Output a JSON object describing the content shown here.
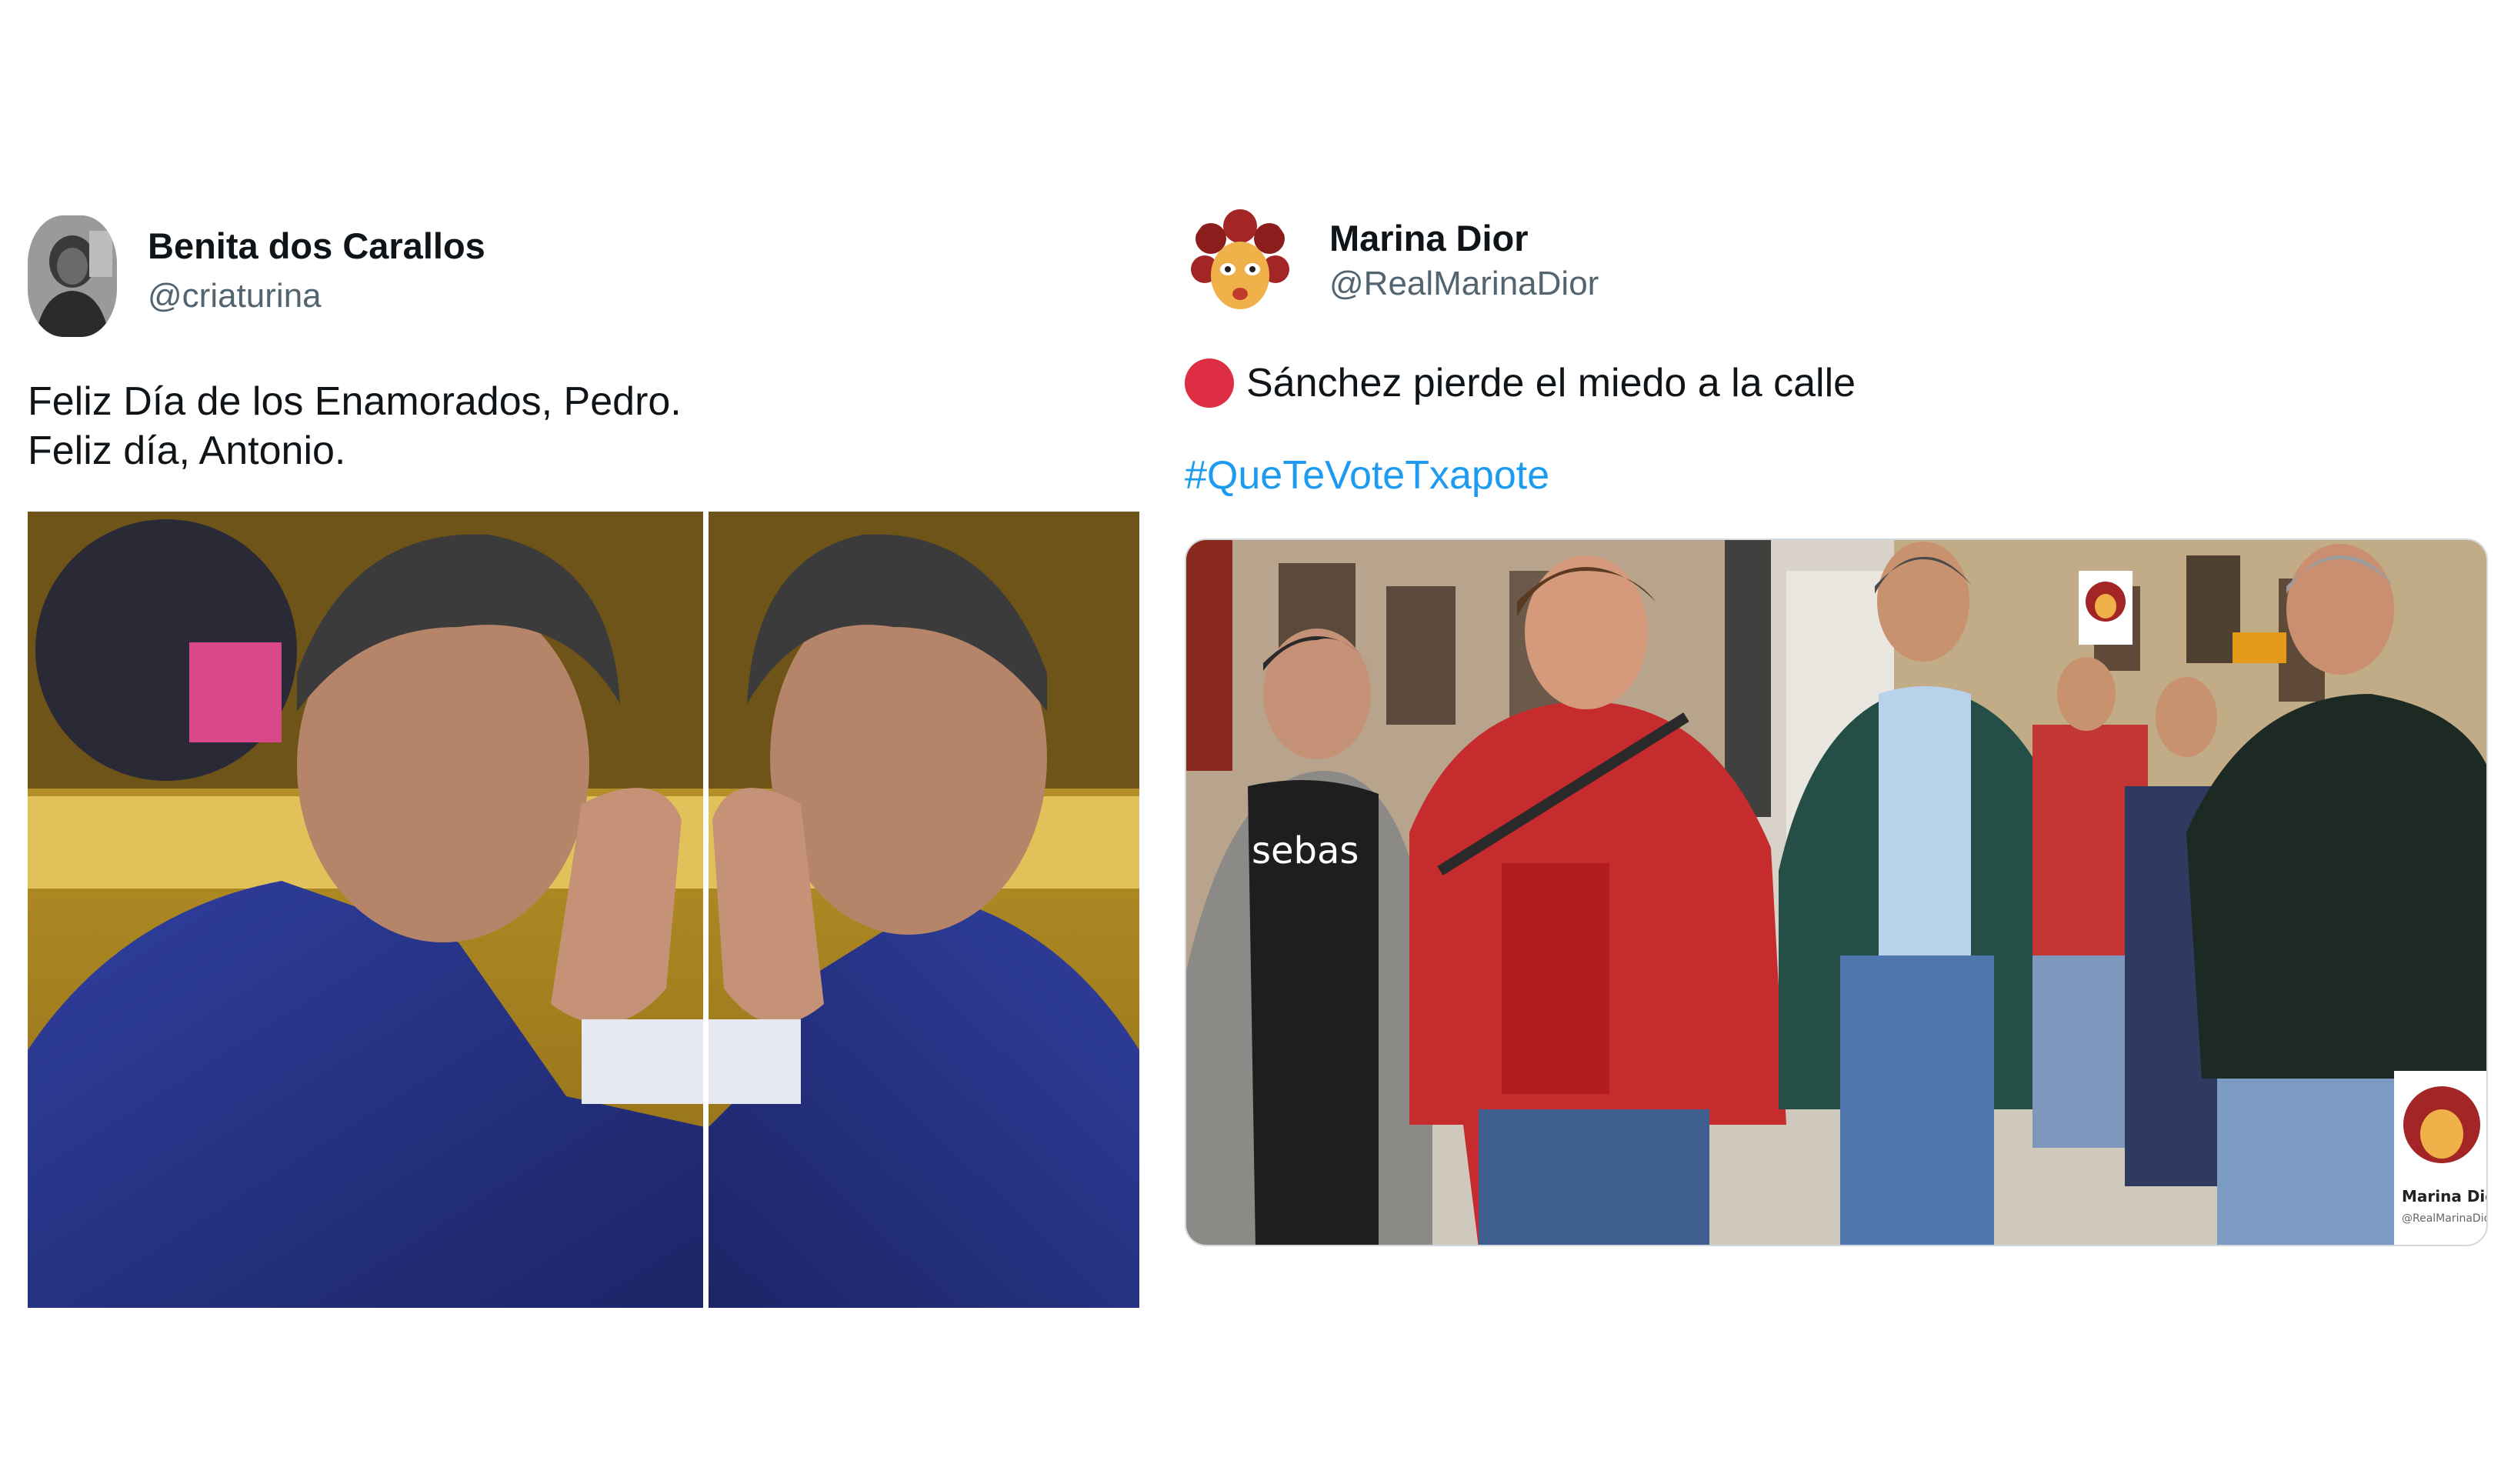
{
  "tweets": [
    {
      "display_name": "Benita dos Carallos",
      "handle": "@criaturina",
      "text_lines": [
        "Feliz Día de los Enamorados, Pedro.",
        "Feliz día, Antonio."
      ]
    },
    {
      "display_name": "Marina Dior",
      "handle": "@RealMarinaDior",
      "status_text": "Sánchez pierde el miedo a la calle",
      "hashtag": "#QueTeVoteTxapote",
      "watermark_name": "Marina Dior",
      "watermark_handle": "@RealMarinaDior",
      "shirt_text": "sebas"
    }
  ],
  "colors": {
    "text_primary": "#0f1419",
    "text_secondary": "#536471",
    "link": "#1d9bf0",
    "red_circle": "#dd2e44"
  },
  "icons": {
    "status_emoji": "red-circle-icon"
  }
}
